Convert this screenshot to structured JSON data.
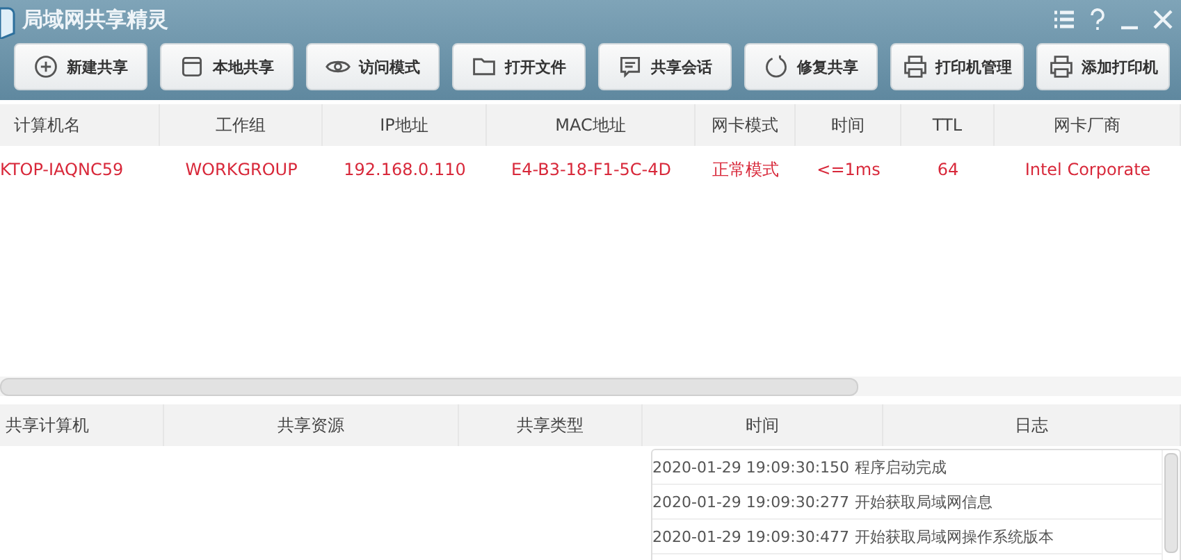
{
  "window": {
    "title": "局域网共享精灵"
  },
  "toolbar": [
    {
      "label": "新建共享",
      "kind": "plus"
    },
    {
      "label": "本地共享",
      "kind": "window"
    },
    {
      "label": "访问模式",
      "kind": "eye"
    },
    {
      "label": "打开文件",
      "kind": "folder"
    },
    {
      "label": "共享会话",
      "kind": "chat"
    },
    {
      "label": "修复共享",
      "kind": "refresh"
    },
    {
      "label": "打印机管理",
      "kind": "printer"
    },
    {
      "label": "添加打印机",
      "kind": "printer"
    }
  ],
  "hosts": {
    "columns": [
      "计算机名",
      "工作组",
      "IP地址",
      "MAC地址",
      "网卡模式",
      "时间",
      "TTL",
      "网卡厂商"
    ],
    "rows": [
      [
        "KTOP-IAQNC59",
        "WORKGROUP",
        "192.168.0.110",
        "E4-B3-18-F1-5C-4D",
        "正常模式",
        "<=1ms",
        "64",
        "Intel Corporate"
      ]
    ]
  },
  "shares": {
    "columns": [
      "共享计算机",
      "共享资源",
      "共享类型"
    ]
  },
  "log": {
    "columns": [
      "时间",
      "日志"
    ],
    "rows": [
      [
        "2020-01-29 19:09:30:150",
        "程序启动完成"
      ],
      [
        "2020-01-29 19:09:30:277",
        "开始获取局域网信息"
      ],
      [
        "2020-01-29 19:09:30:477",
        "开始获取局域网操作系统版本"
      ]
    ]
  }
}
